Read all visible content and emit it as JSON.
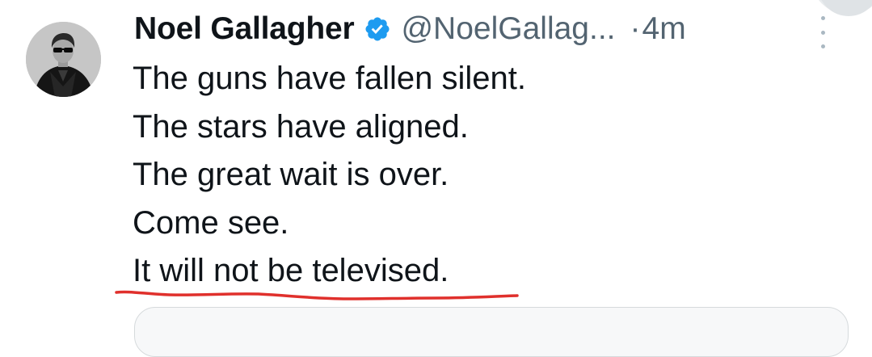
{
  "tweet": {
    "author": {
      "display_name": "Noel Gallagher",
      "handle": "@NoelGallag...",
      "verified_icon": "verified-badge-icon",
      "avatar_icon": "profile-photo"
    },
    "separator": "·",
    "timestamp": "4m",
    "more_icon": "vertical-ellipsis-icon",
    "lines": [
      "The guns have fallen silent.",
      "The stars have aligned.",
      "The great wait is over.",
      "Come see.",
      "It will not be televised."
    ],
    "annotation": {
      "type": "red squiggly underline",
      "target_line": 4,
      "color": "#e0302c"
    }
  },
  "colors": {
    "text_primary": "#0f1419",
    "text_secondary": "#536471",
    "verified_blue": "#1d9bf0",
    "background": "#ffffff"
  }
}
